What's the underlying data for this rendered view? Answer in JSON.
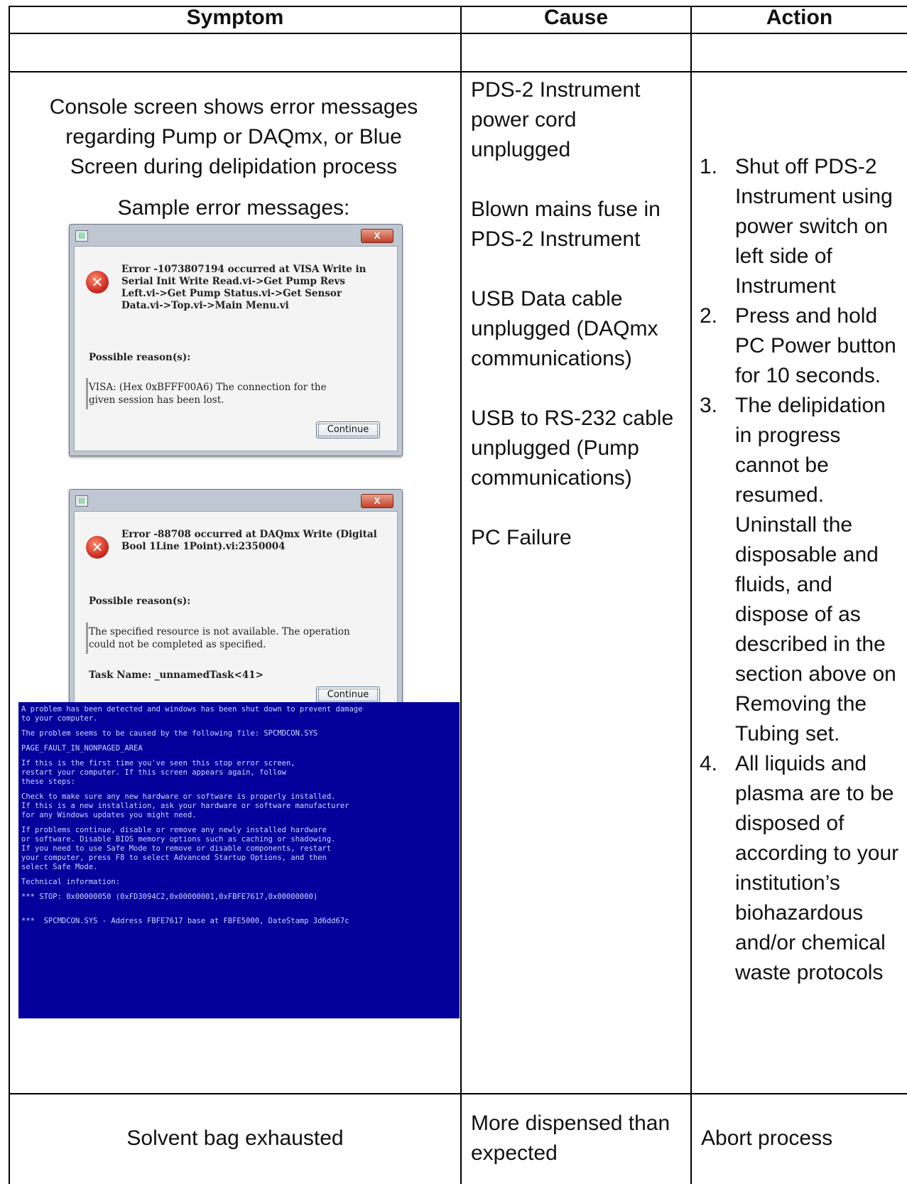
{
  "table": {
    "headers": [
      "Symptom",
      "Cause",
      "Action"
    ],
    "row1": {
      "symptom_lines": [
        "Console screen shows error messages",
        "regarding Pump or DAQmx, or Blue",
        "Screen during delipidation process"
      ],
      "sample_label": "Sample error messages:",
      "causes": [
        "PDS-2 Instrument power cord unplugged",
        "Blown mains fuse in PDS-2 Instrument",
        "USB Data cable unplugged (DAQmx communications)",
        "USB to RS-232 cable unplugged (Pump communications)",
        "PC Failure"
      ],
      "actions": [
        {
          "num": "1.",
          "text": "Shut off PDS-2 Instrument using power switch on left side of Instrument"
        },
        {
          "num": "2.",
          "text": "Press and hold PC Power button for 10 seconds."
        },
        {
          "num": "3.",
          "text": "The delipidation in progress cannot be resumed. Uninstall the disposable and fluids, and dispose of as described in the section above on Removing the Tubing set."
        },
        {
          "num": "4.",
          "text": "All liquids and plasma are to be disposed of according to your institution’s biohazardous and/or chemical waste protocols"
        }
      ]
    },
    "row2": {
      "symptom": "Solvent bag exhausted",
      "cause": "More dispensed than expected",
      "action": "Abort process"
    }
  },
  "dialog1": {
    "close_label": "X",
    "message": "Error -1073807194 occurred at VISA Write in Serial Init Write Read.vi->Get Pump Revs Left.vi->Get Pump Status.vi->Get Sensor Data.vi->Top.vi->Main Menu.vi",
    "reason_heading": "Possible reason(s):",
    "reason_text": "VISA: (Hex 0xBFFF00A6) The connection for the given session has been lost.",
    "button_label": "Continue"
  },
  "dialog2": {
    "close_label": "X",
    "message": "Error -88708 occurred at DAQmx Write (Digital Bool 1Line 1Point).vi:2350004",
    "reason_heading": "Possible reason(s):",
    "reason_text": "The specified resource is not available. The operation could not be completed as specified.",
    "task_label": "Task Name: _unnamedTask<41>",
    "button_label": "Continue"
  },
  "bsod": {
    "lines": [
      "A problem has been detected and windows has been shut down to prevent damage\nto your computer.",
      "The problem seems to be caused by the following file: SPCMDCON.SYS",
      "PAGE_FAULT_IN_NONPAGED_AREA",
      "If this is the first time you've seen this stop error screen,\nrestart your computer. If this screen appears again, follow\nthese steps:",
      "Check to make sure any new hardware or software is properly installed.\nIf this is a new installation, ask your hardware or software manufacturer\nfor any Windows updates you might need.",
      "If problems continue, disable or remove any newly installed hardware\nor software. Disable BIOS memory options such as caching or shadowing.\nIf you need to use Safe Mode to remove or disable components, restart\nyour computer, press F8 to select Advanced Startup Options, and then\nselect Safe Mode.",
      "Technical information:",
      "*** STOP: 0x00000050 (0xFD3094C2,0x00000001,0xFBFE7617,0x00000000)",
      "\n***  SPCMDCON.SYS - Address FBFE7617 base at FBFE5000, DateStamp 3d6dd67c"
    ]
  }
}
